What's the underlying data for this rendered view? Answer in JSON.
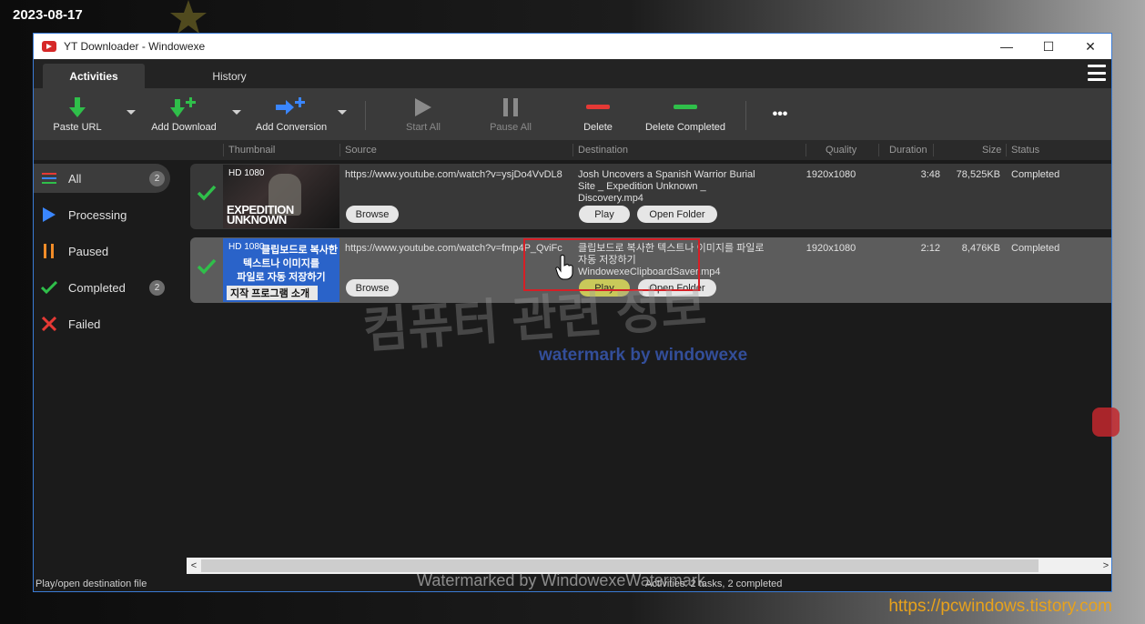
{
  "overlay": {
    "date": "2023-08-17",
    "site_url": "https://pcwindows.tistory.com",
    "watermark_korean": "컴퓨터 관련 정보",
    "watermark_by": "watermark by windowexe",
    "watermark_bottom": "Watermarked by WindowexeWatermark"
  },
  "window": {
    "title": "YT Downloader   - Windowexe",
    "minimize": "—",
    "maximize": "☐",
    "close": "✕"
  },
  "tabs": [
    {
      "label": "Activities",
      "active": true
    },
    {
      "label": "History",
      "active": false
    }
  ],
  "toolbar": {
    "paste_url": "Paste URL",
    "add_download": "Add Download",
    "add_conversion": "Add Conversion",
    "start_all": "Start All",
    "pause_all": "Pause All",
    "delete": "Delete",
    "delete_completed": "Delete Completed",
    "more": "•••"
  },
  "columns": {
    "thumbnail": "Thumbnail",
    "source": "Source",
    "destination": "Destination",
    "quality": "Quality",
    "duration": "Duration",
    "size": "Size",
    "status": "Status"
  },
  "sidebar": {
    "items": [
      {
        "label": "All",
        "badge": "2",
        "color": "#3a86ff"
      },
      {
        "label": "Processing",
        "badge": "",
        "color": "#3a86ff"
      },
      {
        "label": "Paused",
        "badge": "",
        "color": "#f28c28"
      },
      {
        "label": "Completed",
        "badge": "2",
        "color": "#2fbf4a"
      },
      {
        "label": "Failed",
        "badge": "",
        "color": "#e53935"
      }
    ]
  },
  "rows": [
    {
      "thumb_quality": "HD 1080",
      "thumb_title": "EXPEDITION UNKNOWN",
      "source": "https://www.youtube.com/watch?v=ysjDo4VvDL8",
      "destination": "Josh Uncovers a Spanish Warrior Burial Site _ Expedition Unknown _ Discovery.mp4",
      "quality": "1920x1080",
      "duration": "3:48",
      "size": "78,525KB",
      "status": "Completed",
      "browse": "Browse",
      "play": "Play",
      "open_folder": "Open Folder"
    },
    {
      "thumb_quality": "HD 1080",
      "thumb_line1": "클립보드로 복사한",
      "thumb_line2": "텍스트나 이미지를",
      "thumb_line3": "파일로 자동 저장하기",
      "thumb_line4": "지작 프로그램 소개",
      "source": "https://www.youtube.com/watch?v=fmp4P_QviFc",
      "destination": "클립보드로 복사한 텍스트나 이미지를 파일로 자동 저장하기 WindowexeClipboardSaver.mp4",
      "quality": "1920x1080",
      "duration": "2:12",
      "size": "8,476KB",
      "status": "Completed",
      "browse": "Browse",
      "play": "Play",
      "open_folder": "Open Folder"
    }
  ],
  "statusbar": {
    "hint": "Play/open destination file",
    "summary": "Activities: 2 tasks, 2 completed"
  },
  "colors": {
    "accent_green": "#2fbf4a",
    "accent_red": "#e53935",
    "accent_blue": "#3a86ff",
    "window_border": "#3a7bd5",
    "highlight_box": "#d61f26"
  }
}
